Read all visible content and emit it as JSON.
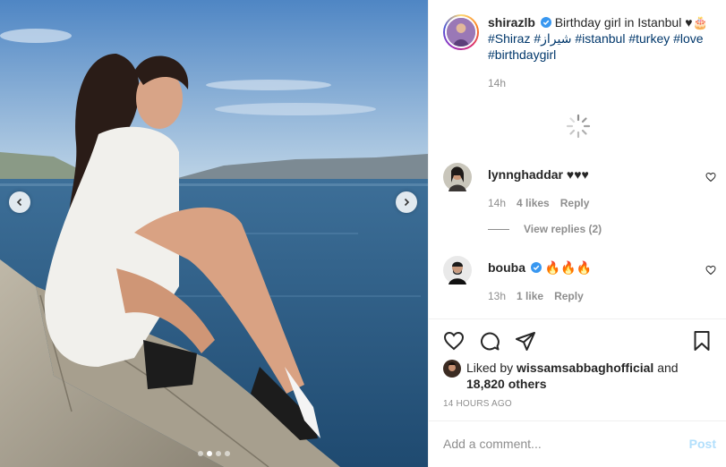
{
  "post": {
    "author": "shirazlb",
    "caption_text": "Birthday girl in Istanbul ♥",
    "caption_tail": "🎂",
    "hashtags_line1": "#Shiraz #شيراز #istanbul #turkey #love",
    "hashtags_line2": "#birthdaygirl",
    "time_ago": "14h"
  },
  "comments": [
    {
      "username": "lynnghaddar",
      "text": "♥♥♥",
      "time": "14h",
      "likes": "4 likes",
      "reply": "Reply"
    },
    {
      "username": "bouba",
      "text": "🔥🔥🔥",
      "time": "13h",
      "likes": "1 like",
      "reply": "Reply"
    }
  ],
  "view_replies": "View replies (2)",
  "liked_by": {
    "prefix": "Liked by",
    "user": "wissamsabbaghofficial",
    "conj": "and",
    "others": "18,820 others"
  },
  "timestamp": "14 HOURS AGO",
  "add_comment": {
    "placeholder": "Add a comment...",
    "post_label": "Post"
  },
  "icons": {
    "nav_prev": "chevron-left-icon",
    "nav_next": "chevron-right-icon",
    "like": "heart-outline-icon",
    "comment": "comment-bubble-icon",
    "share": "paper-plane-icon",
    "save": "bookmark-icon",
    "verified": "verified-badge-icon",
    "loading": "spinner-icon"
  },
  "colors": {
    "verified": "#3897f0",
    "hashtag": "#00376b",
    "muted": "#8e8e8e",
    "post_button": "#b2dffc"
  },
  "carousel": {
    "slides": 4,
    "active": 1
  }
}
